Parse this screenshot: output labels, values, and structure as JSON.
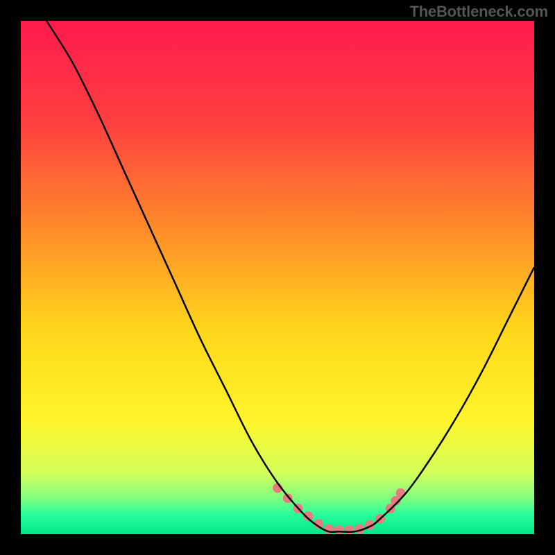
{
  "attribution": "TheBottleneck.com",
  "chart_data": {
    "type": "line",
    "title": "",
    "xlabel": "",
    "ylabel": "",
    "xlim": [
      0,
      100
    ],
    "ylim": [
      0,
      100
    ],
    "series": [
      {
        "name": "bottleneck-curve",
        "x": [
          5,
          10,
          15,
          20,
          25,
          30,
          35,
          40,
          45,
          50,
          55,
          58,
          60,
          62,
          65,
          68,
          70,
          75,
          80,
          85,
          90,
          95,
          100
        ],
        "y": [
          100,
          92,
          82,
          71,
          60,
          49,
          38,
          28,
          18,
          10,
          4,
          1.5,
          0.5,
          0.5,
          0.5,
          1.5,
          3,
          8,
          15,
          23,
          32,
          42,
          52
        ]
      }
    ],
    "markers_x": [
      50,
      52,
      54,
      56,
      58,
      60,
      62,
      64,
      66,
      68,
      70,
      72,
      73,
      74
    ],
    "markers_y": [
      9,
      7,
      5,
      3.5,
      2,
      1,
      0.8,
      0.8,
      1,
      1.8,
      3,
      5,
      6.5,
      8
    ],
    "gradient_stops": [
      {
        "offset": 0.0,
        "color": "#ff1a4d"
      },
      {
        "offset": 0.2,
        "color": "#ff4040"
      },
      {
        "offset": 0.4,
        "color": "#ff8a2a"
      },
      {
        "offset": 0.6,
        "color": "#ffd61a"
      },
      {
        "offset": 0.78,
        "color": "#fff52a"
      },
      {
        "offset": 0.88,
        "color": "#d4ff5a"
      },
      {
        "offset": 0.93,
        "color": "#80ff80"
      },
      {
        "offset": 0.96,
        "color": "#2aff99"
      },
      {
        "offset": 1.0,
        "color": "#00e68a"
      }
    ],
    "marker_color": "#e77c80",
    "curve_color": "#000000"
  }
}
